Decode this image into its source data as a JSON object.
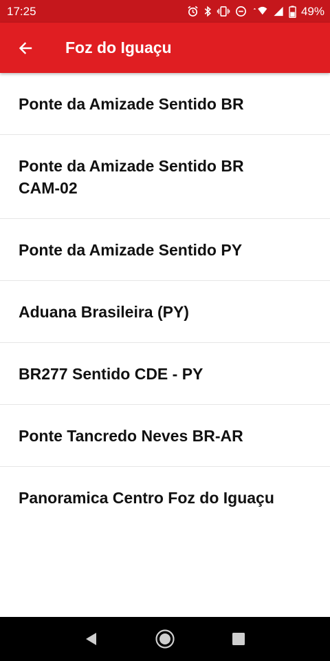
{
  "status_bar": {
    "time": "17:25",
    "battery_percent": "49%",
    "icons": [
      "alarm-icon",
      "bluetooth-icon",
      "vibrate-icon",
      "do-not-disturb-icon",
      "wifi-icon",
      "signal-icon",
      "battery-icon"
    ]
  },
  "app_bar": {
    "back_icon": "arrow-left-icon",
    "title": "Foz do Iguaçu"
  },
  "list": {
    "items": [
      {
        "label": "Ponte da Amizade Sentido BR"
      },
      {
        "label": "Ponte da Amizade Sentido BR\nCAM-02"
      },
      {
        "label": "Ponte da Amizade Sentido PY"
      },
      {
        "label": "Aduana Brasileira (PY)"
      },
      {
        "label": "BR277 Sentido CDE - PY"
      },
      {
        "label": "Ponte Tancredo Neves BR-AR"
      },
      {
        "label": "Panoramica Centro Foz do Iguaçu"
      }
    ]
  },
  "nav_bar": {
    "buttons": [
      "back-triangle-icon",
      "home-circle-icon",
      "recents-square-icon"
    ]
  },
  "colors": {
    "status_bar": "#c5171c",
    "app_bar": "#e01e22",
    "text": "#111111",
    "divider": "#e6e6e6",
    "nav_bar": "#000000"
  }
}
